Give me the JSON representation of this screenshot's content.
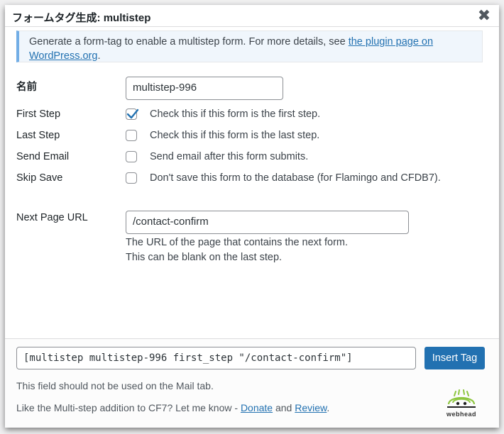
{
  "dialog": {
    "title": "フォームタグ生成: multistep",
    "close_glyph": "✖"
  },
  "notice": {
    "text": "Generate a form-tag to enable a multistep form. For more details, see ",
    "link_text": "the plugin page on WordPress.org",
    "suffix": "."
  },
  "form": {
    "name_label": "名前",
    "name_value": "multistep-996",
    "rows": [
      {
        "label": "First Step",
        "checked": true,
        "text": "Check this if this form is the first step."
      },
      {
        "label": "Last Step",
        "checked": false,
        "text": "Check this if this form is the last step."
      },
      {
        "label": "Send Email",
        "checked": false,
        "text": "Send email after this form submits."
      },
      {
        "label": "Skip Save",
        "checked": false,
        "text": "Don't save this form to the database (for Flamingo and CFDB7)."
      }
    ],
    "next_url_label": "Next Page URL",
    "next_url_value": "/contact-confirm",
    "next_url_help_1": "The URL of the page that contains the next form.",
    "next_url_help_2": "This can be blank on the last step."
  },
  "footer": {
    "tag_value": "[multistep multistep-996 first_step \"/contact-confirm\"]",
    "insert_button": "Insert Tag",
    "mail_note": "This field should not be used on the Mail tab.",
    "promo_prefix": "Like the Multi-step addition to CF7? Let me know - ",
    "promo_link_donate": "Donate",
    "promo_and": " and ",
    "promo_link_review": "Review",
    "promo_suffix": ".",
    "logo_text": "webhead"
  },
  "colors": {
    "accent": "#2271b1",
    "notice_border": "#72aee6",
    "notice_bg": "#f0f6fc"
  }
}
